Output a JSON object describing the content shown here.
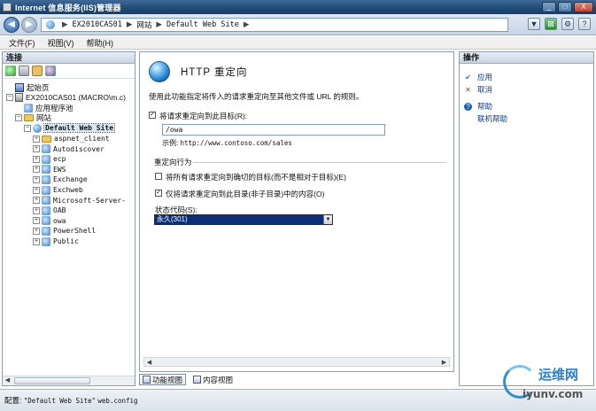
{
  "window": {
    "title": "Internet 信息服务(IIS)管理器",
    "minimize_glyph": "_",
    "maximize_glyph": "□",
    "close_glyph": "X"
  },
  "address": {
    "back_glyph": "◀",
    "forward_glyph": "▶",
    "crumbs": [
      "EX2010CAS01",
      "网站",
      "Default Web Site"
    ],
    "separator": "▶",
    "tools": [
      "▼",
      "⊠",
      "⚙",
      "?"
    ]
  },
  "menu": [
    "文件(F)",
    "视图(V)",
    "帮助(H)"
  ],
  "connections": {
    "header": "连接",
    "tree": [
      {
        "label": "起始页",
        "icon": "home-icon",
        "level": 0,
        "expander": ""
      },
      {
        "label": "EX2010CAS01 (MACRO\\m.c)",
        "icon": "server-icon",
        "level": 0,
        "expander": "−"
      },
      {
        "label": "应用程序池",
        "icon": "app-pool-icon",
        "level": 1,
        "expander": ""
      },
      {
        "label": "网站",
        "icon": "sites-folder-icon",
        "level": 1,
        "expander": "−"
      },
      {
        "label": "Default Web Site",
        "icon": "globe-icon",
        "level": 2,
        "expander": "−",
        "selected": true
      },
      {
        "label": "aspnet_client",
        "icon": "folder-icon",
        "level": 3,
        "expander": "+"
      },
      {
        "label": "Autodiscover",
        "icon": "app-icon",
        "level": 3,
        "expander": "+"
      },
      {
        "label": "ecp",
        "icon": "app-icon",
        "level": 3,
        "expander": "+"
      },
      {
        "label": "EWS",
        "icon": "app-icon",
        "level": 3,
        "expander": "+"
      },
      {
        "label": "Exchange",
        "icon": "app-icon",
        "level": 3,
        "expander": "+"
      },
      {
        "label": "Exchweb",
        "icon": "app-icon",
        "level": 3,
        "expander": "+"
      },
      {
        "label": "Microsoft-Server-",
        "icon": "app-icon",
        "level": 3,
        "expander": "+"
      },
      {
        "label": "OAB",
        "icon": "app-icon",
        "level": 3,
        "expander": "+"
      },
      {
        "label": "owa",
        "icon": "app-icon",
        "level": 3,
        "expander": "+"
      },
      {
        "label": "PowerShell",
        "icon": "app-icon",
        "level": 3,
        "expander": "+"
      },
      {
        "label": "Public",
        "icon": "app-icon",
        "level": 3,
        "expander": "+"
      }
    ]
  },
  "main": {
    "title": "HTTP 重定向",
    "description": "使用此功能指定将传入的请求重定向至其他文件或 URL 的规则。",
    "redirect_checkbox": {
      "label": "将请求重定向到此目标(R):",
      "checked": true
    },
    "redirect_target": "/owa",
    "example_label": "示例:",
    "example_value": "http://www.contoso.com/sales",
    "behavior_group": "重定向行为",
    "exact_checkbox": {
      "label": "将所有请求重定向到确切的目标(而不是相对于目标)(E)",
      "checked": false
    },
    "only_dir_checkbox": {
      "label": "仅将请求重定向到此目录(非子目录)中的内容(O)",
      "checked": true
    },
    "status_code_label": "状态代码(S):",
    "status_code_value": "永久(301)",
    "check_glyph": "✓"
  },
  "view_tabs": [
    "功能视图",
    "内容视图"
  ],
  "actions": {
    "header": "操作",
    "items": [
      {
        "label": "应用",
        "icon": "apply-icon",
        "glyph": "✔"
      },
      {
        "label": "取消",
        "icon": "cancel-icon",
        "glyph": "✕"
      },
      {
        "label": "帮助",
        "icon": "help-icon",
        "glyph": "?"
      },
      {
        "label": "联机帮助",
        "icon": "",
        "glyph": ""
      }
    ]
  },
  "status": {
    "prefix": "配置:",
    "site": "\"Default Web Site\"",
    "file": "web.config"
  },
  "watermark": {
    "name": "运维网",
    "url": "iyunv.com"
  },
  "colors": {
    "title_bar": "#1f4a76",
    "selected_dropdown": "#0a2e7a",
    "link": "#0b3c90"
  }
}
